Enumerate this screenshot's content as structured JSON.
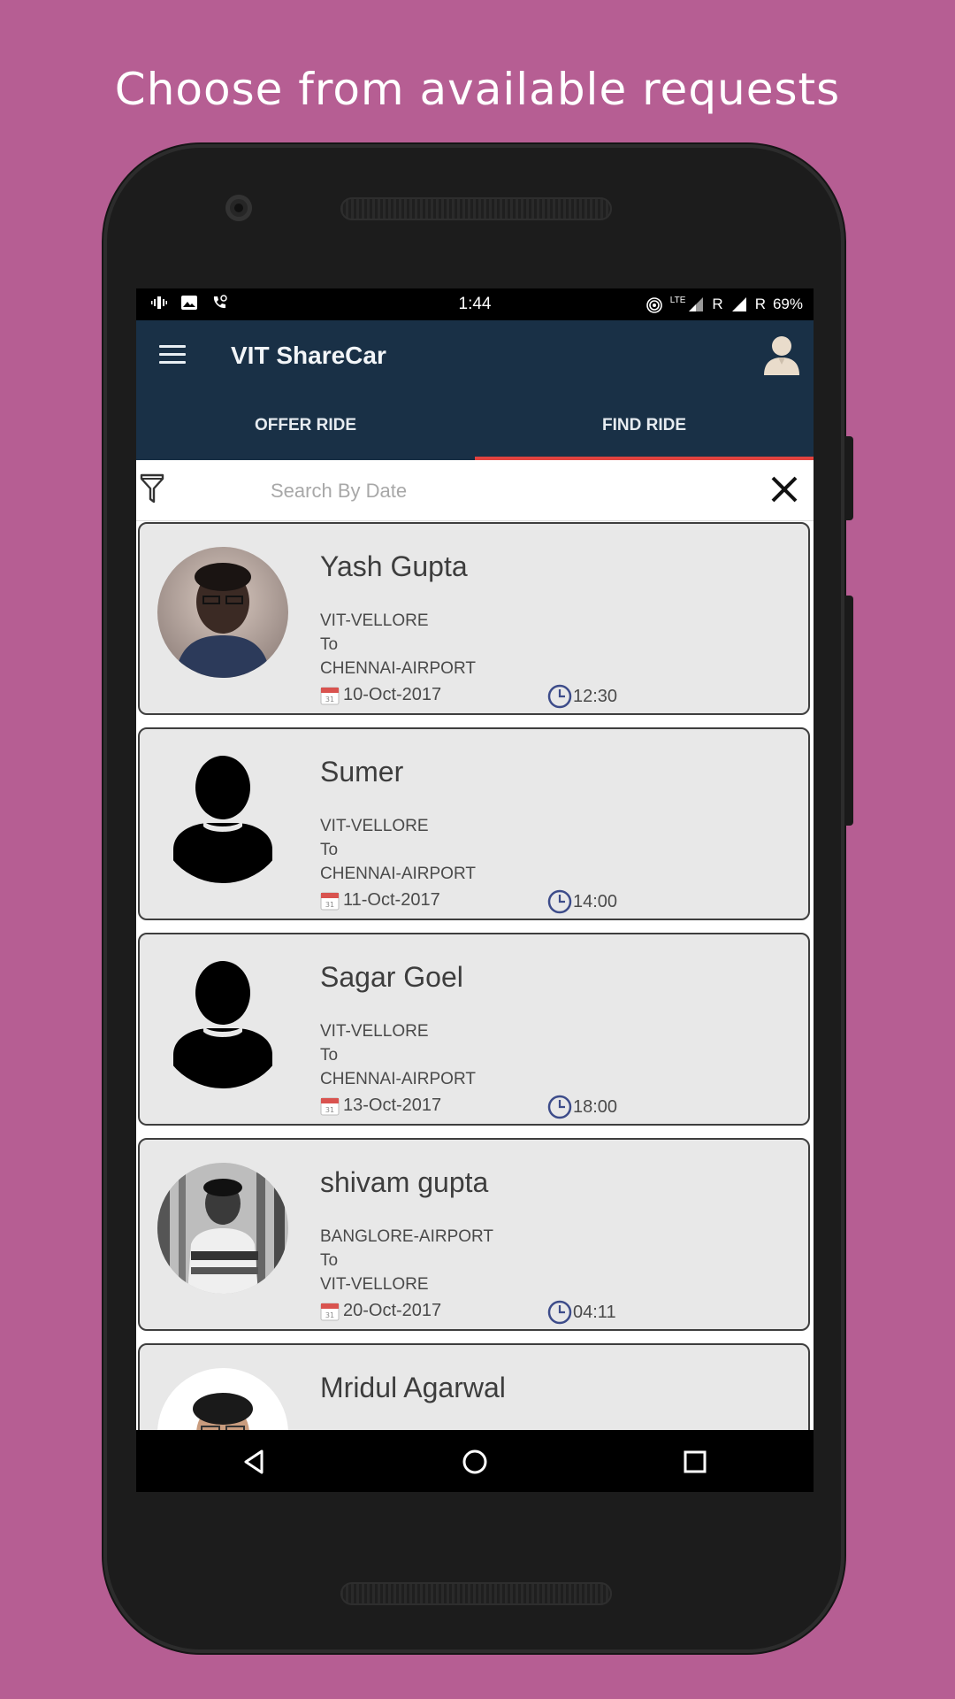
{
  "headline": "Choose from available requests",
  "status_bar": {
    "time": "1:44",
    "network": "LTE",
    "roaming1": "R",
    "roaming2": "R",
    "battery": "69%"
  },
  "app": {
    "title": "VIT ShareCar",
    "tabs": [
      {
        "label": "OFFER RIDE",
        "active": false
      },
      {
        "label": "FIND RIDE",
        "active": true
      }
    ],
    "accent_color": "#e2433f",
    "bar_color": "#193046"
  },
  "search": {
    "placeholder": "Search By Date"
  },
  "rides": [
    {
      "name": "Yash Gupta",
      "from": "VIT-VELLORE",
      "to_word": "To",
      "to": "CHENNAI-AIRPORT",
      "date": "10-Oct-2017",
      "time": "12:30",
      "avatar": "photo-person"
    },
    {
      "name": "Sumer",
      "from": "VIT-VELLORE",
      "to_word": "To",
      "to": "CHENNAI-AIRPORT",
      "date": "11-Oct-2017",
      "time": "14:00",
      "avatar": "silhouette"
    },
    {
      "name": "Sagar Goel",
      "from": "VIT-VELLORE",
      "to_word": "To",
      "to": "CHENNAI-AIRPORT",
      "date": "13-Oct-2017",
      "time": "18:00",
      "avatar": "silhouette"
    },
    {
      "name": "shivam gupta",
      "from": "BANGLORE-AIRPORT",
      "to_word": "To",
      "to": "VIT-VELLORE",
      "date": "20-Oct-2017",
      "time": "04:11",
      "avatar": "photo-person-bw"
    },
    {
      "name": "Mridul Agarwal",
      "from": "",
      "to_word": "",
      "to": "",
      "date": "",
      "time": "",
      "avatar": "photo-person"
    }
  ],
  "icons": {
    "menu": "hamburger-icon",
    "profile": "profile-icon",
    "filter": "filter-icon",
    "close": "close-icon",
    "calendar": "calendar-icon",
    "clock": "clock-icon",
    "nav_back": "back-triangle-icon",
    "nav_home": "home-circle-icon",
    "nav_recents": "recents-square-icon"
  }
}
